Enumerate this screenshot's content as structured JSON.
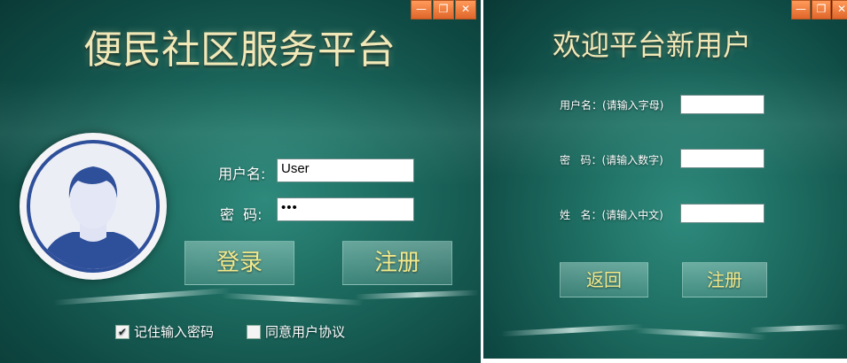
{
  "login": {
    "title": "便民社区服务平台",
    "username_label": "用户名:",
    "username_value": "User",
    "password_label": "密  码:",
    "password_value": "•••",
    "login_button": "登录",
    "register_button": "注册",
    "remember_password": "记住输入密码",
    "remember_checked": "✔",
    "agree_terms": "同意用户协议",
    "agree_checked": ""
  },
  "register": {
    "title": "欢迎平台新用户",
    "username_label": "用户名：(请输入字母)",
    "password_label": "密   码：(请输入数字)",
    "name_label": "姓   名：(请输入中文)",
    "back_button": "返回",
    "register_button": "注册"
  },
  "window_controls": {
    "minimize": "—",
    "restore": "❐",
    "close": "✕"
  },
  "colors": {
    "title_gold": "#f1e8b8",
    "button_text": "#f3e98a",
    "control_orange": "#f07a3a",
    "avatar_blue": "#2e4f9a"
  }
}
